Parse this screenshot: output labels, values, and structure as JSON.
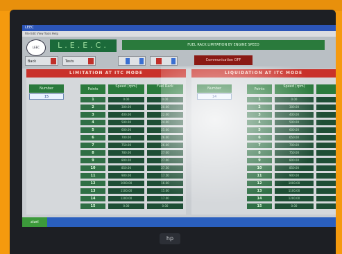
{
  "window": {
    "title": "LEEC",
    "menu": "File  Edit  View  Tools  Help"
  },
  "header": {
    "logo_text": "LEEC",
    "brand": "L.E.E.C.",
    "main_title": "FUEL RACK LIMITATION BY ENGINE SPEED",
    "left_button": "Back",
    "right_button": "Tests",
    "alert_text": "Communication OFF"
  },
  "left_panel": {
    "title": "LIMITATION AT ITC MODE",
    "number_label": "Number",
    "number_value": "15",
    "columns": {
      "points": "Points",
      "speed": "Speed (rpm)",
      "rack": "Fuel Rack"
    },
    "rows": [
      {
        "point": "1",
        "speed": "0.00",
        "rack": "0.00"
      },
      {
        "point": "2",
        "speed": "300.00",
        "rack": "20.00"
      },
      {
        "point": "3",
        "speed": "400.00",
        "rack": "22.00"
      },
      {
        "point": "4",
        "speed": "500.00",
        "rack": "24.00"
      },
      {
        "point": "5",
        "speed": "600.00",
        "rack": "25.00"
      },
      {
        "point": "6",
        "speed": "700.00",
        "rack": "26.00"
      },
      {
        "point": "7",
        "speed": "750.00",
        "rack": "26.00"
      },
      {
        "point": "8",
        "speed": "780.00",
        "rack": "27.00"
      },
      {
        "point": "9",
        "speed": "800.00",
        "rack": "27.00"
      },
      {
        "point": "10",
        "speed": "850.00",
        "rack": "27.50"
      },
      {
        "point": "11",
        "speed": "900.00",
        "rack": "17.50"
      },
      {
        "point": "12",
        "speed": "1000.00",
        "rack": "16.00"
      },
      {
        "point": "13",
        "speed": "1100.00",
        "rack": "15.00"
      },
      {
        "point": "14",
        "speed": "1200.00",
        "rack": "17.00"
      },
      {
        "point": "15",
        "speed": "0.00",
        "rack": "0.00"
      }
    ]
  },
  "right_panel": {
    "title": "LIQUIDATION AT ITC MODE",
    "number_label": "Number",
    "number_value": "14",
    "columns": {
      "points": "Points",
      "speed": "Speed (rpm)"
    },
    "rows": [
      {
        "point": "1",
        "speed": "0.00"
      },
      {
        "point": "2",
        "speed": "300.00"
      },
      {
        "point": "3",
        "speed": "400.00"
      },
      {
        "point": "4",
        "speed": "500.00"
      },
      {
        "point": "5",
        "speed": "600.00"
      },
      {
        "point": "6",
        "speed": "650.00"
      },
      {
        "point": "7",
        "speed": "700.00"
      },
      {
        "point": "8",
        "speed": "750.00"
      },
      {
        "point": "9",
        "speed": "800.00"
      },
      {
        "point": "10",
        "speed": "850.00"
      },
      {
        "point": "11",
        "speed": "900.00"
      },
      {
        "point": "12",
        "speed": "1000.00"
      },
      {
        "point": "13",
        "speed": "1100.00"
      },
      {
        "point": "14",
        "speed": "1200.00"
      },
      {
        "point": "15",
        "speed": "0.00"
      }
    ]
  },
  "taskbar": {
    "start_label": "start"
  },
  "bezel": {
    "brand": "hp"
  }
}
